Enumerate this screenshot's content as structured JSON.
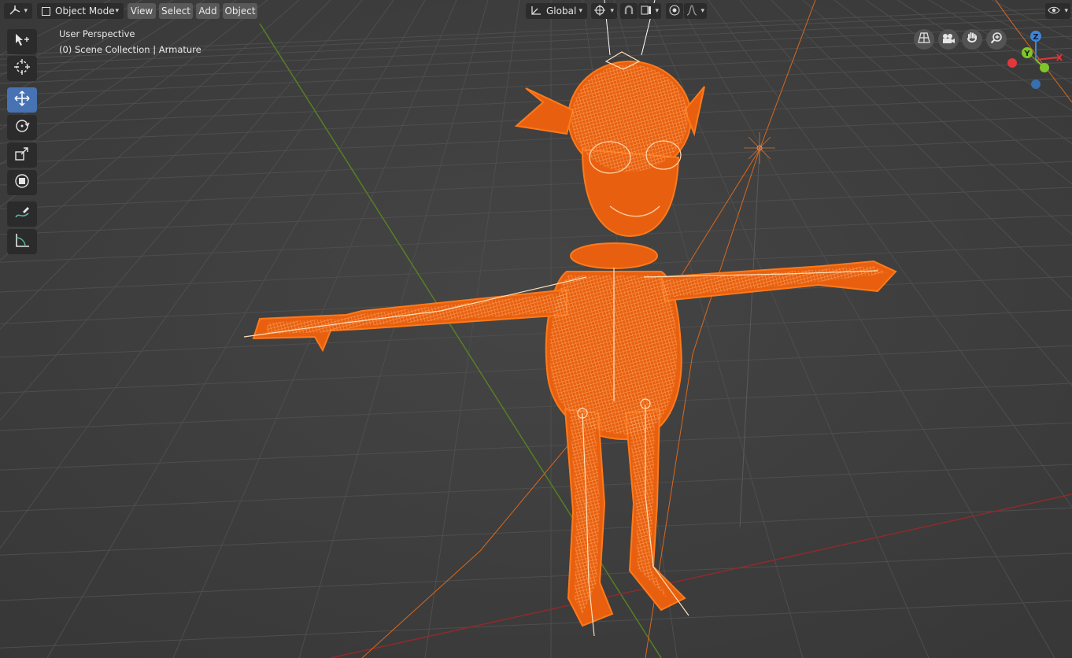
{
  "header": {
    "editor_type_icon": "view3d-icon",
    "mode_label": "Object Mode",
    "menus": [
      "View",
      "Select",
      "Add",
      "Object"
    ],
    "transform_orientation": "Global",
    "transform_orientation_icon": "orientation-icon",
    "pivot_icon": "pivot-icon",
    "snap_icon": "snap-magnet-icon",
    "snap_target_icon": "snap-target-icon",
    "proportional_icon": "proportional-edit-icon",
    "falloff_icon": "falloff-curve-icon",
    "visibility_icon": "eye-visibility-icon"
  },
  "toolbar": {
    "tools": [
      {
        "name": "select-box",
        "icon": "select-box-icon",
        "active": false
      },
      {
        "name": "cursor",
        "icon": "cursor-icon",
        "active": false
      },
      {
        "name": "move",
        "icon": "move-icon",
        "active": true
      },
      {
        "name": "rotate",
        "icon": "rotate-icon",
        "active": false
      },
      {
        "name": "scale",
        "icon": "scale-icon",
        "active": false
      },
      {
        "name": "transform",
        "icon": "transform-icon",
        "active": false
      },
      {
        "name": "annotate",
        "icon": "annotate-icon",
        "active": false
      },
      {
        "name": "measure",
        "icon": "measure-icon",
        "active": false
      }
    ]
  },
  "viewport": {
    "view_name": "User Perspective",
    "collection_info": "(0) Scene Collection | Armature",
    "grid_color": "#4a4a4a",
    "background": "#3d3d3d",
    "selection_color": "#ff6a00",
    "x_axis_color": "#a82c2c",
    "y_axis_color": "#5c8a1e"
  },
  "navigation": {
    "buttons": [
      "perspective-grid-icon",
      "camera-icon",
      "hand-pan-icon",
      "zoom-icon"
    ],
    "gizmo": {
      "x_label": "X",
      "y_label": "Y",
      "z_label": "Z",
      "x_color": "#e0383c",
      "y_color": "#7fc62a",
      "z_color": "#3f86d6"
    }
  }
}
